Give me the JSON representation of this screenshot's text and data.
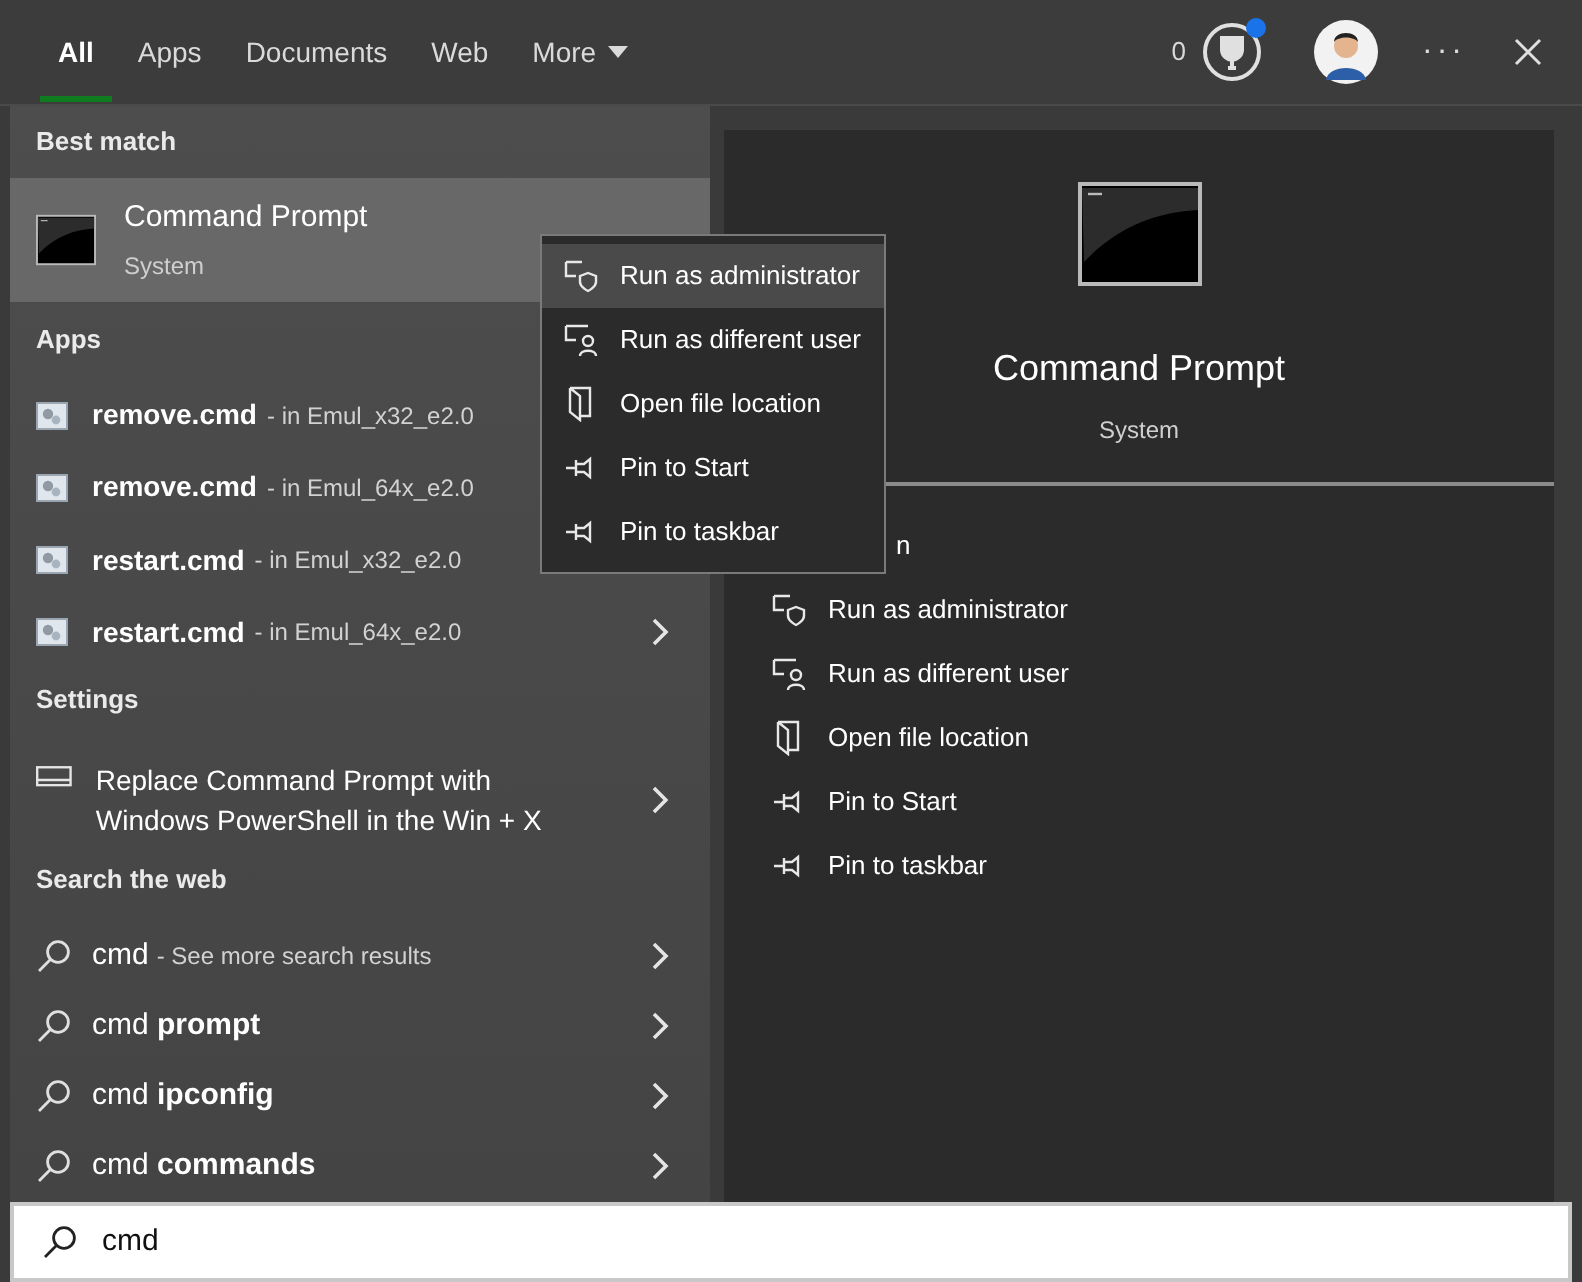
{
  "tabs": [
    {
      "label": "All",
      "selected": true,
      "dropdown": false
    },
    {
      "label": "Apps",
      "selected": false,
      "dropdown": false
    },
    {
      "label": "Documents",
      "selected": false,
      "dropdown": false
    },
    {
      "label": "Web",
      "selected": false,
      "dropdown": false
    },
    {
      "label": "More",
      "selected": false,
      "dropdown": true
    }
  ],
  "header_right": {
    "points": "0",
    "notification": true,
    "more": "···"
  },
  "best_match": {
    "heading": "Best match",
    "title": "Command Prompt",
    "subtitle": "System",
    "selected": true
  },
  "apps": {
    "heading": "Apps",
    "items": [
      {
        "name": "remove.cmd",
        "detail": "- in Emul_x32_e2.0",
        "chevron": false
      },
      {
        "name": "remove.cmd",
        "detail": "- in Emul_64x_e2.0",
        "chevron": false
      },
      {
        "name": "restart.cmd",
        "detail": "- in Emul_x32_e2.0",
        "chevron": false
      },
      {
        "name": "restart.cmd",
        "detail": "- in Emul_64x_e2.0",
        "chevron": true
      }
    ]
  },
  "settings": {
    "heading": "Settings",
    "items": [
      {
        "text": "Replace Command Prompt with Windows PowerShell in the Win + X",
        "chevron": true
      }
    ]
  },
  "web": {
    "heading": "Search the web",
    "items": [
      {
        "text": "cmd",
        "detail": "- See more search results",
        "chevron": true
      },
      {
        "text": "cmd **prompt**",
        "chevron": true
      },
      {
        "text": "cmd **ipconfig**",
        "chevron": true
      },
      {
        "text": "cmd **commands**",
        "chevron": true
      }
    ]
  },
  "context_menu": {
    "items": [
      {
        "label": "Run as administrator",
        "kind": "admin",
        "selected": true
      },
      {
        "label": "Run as different user",
        "kind": "user",
        "selected": false
      },
      {
        "label": "Open file location",
        "kind": "folder",
        "selected": false
      },
      {
        "label": "Pin to Start",
        "kind": "pin",
        "selected": false
      },
      {
        "label": "Pin to taskbar",
        "kind": "pin",
        "selected": false
      }
    ]
  },
  "preview": {
    "title": "Command Prompt",
    "subtitle": "System",
    "actions": [
      {
        "label": "n",
        "kind": "covered"
      },
      {
        "label": "Run as administrator",
        "kind": "admin"
      },
      {
        "label": "Run as different user",
        "kind": "user"
      },
      {
        "label": "Open file location",
        "kind": "folder"
      },
      {
        "label": "Pin to Start",
        "kind": "pin"
      },
      {
        "label": "Pin to taskbar",
        "kind": "pin"
      }
    ]
  },
  "search": {
    "value": "cmd"
  }
}
